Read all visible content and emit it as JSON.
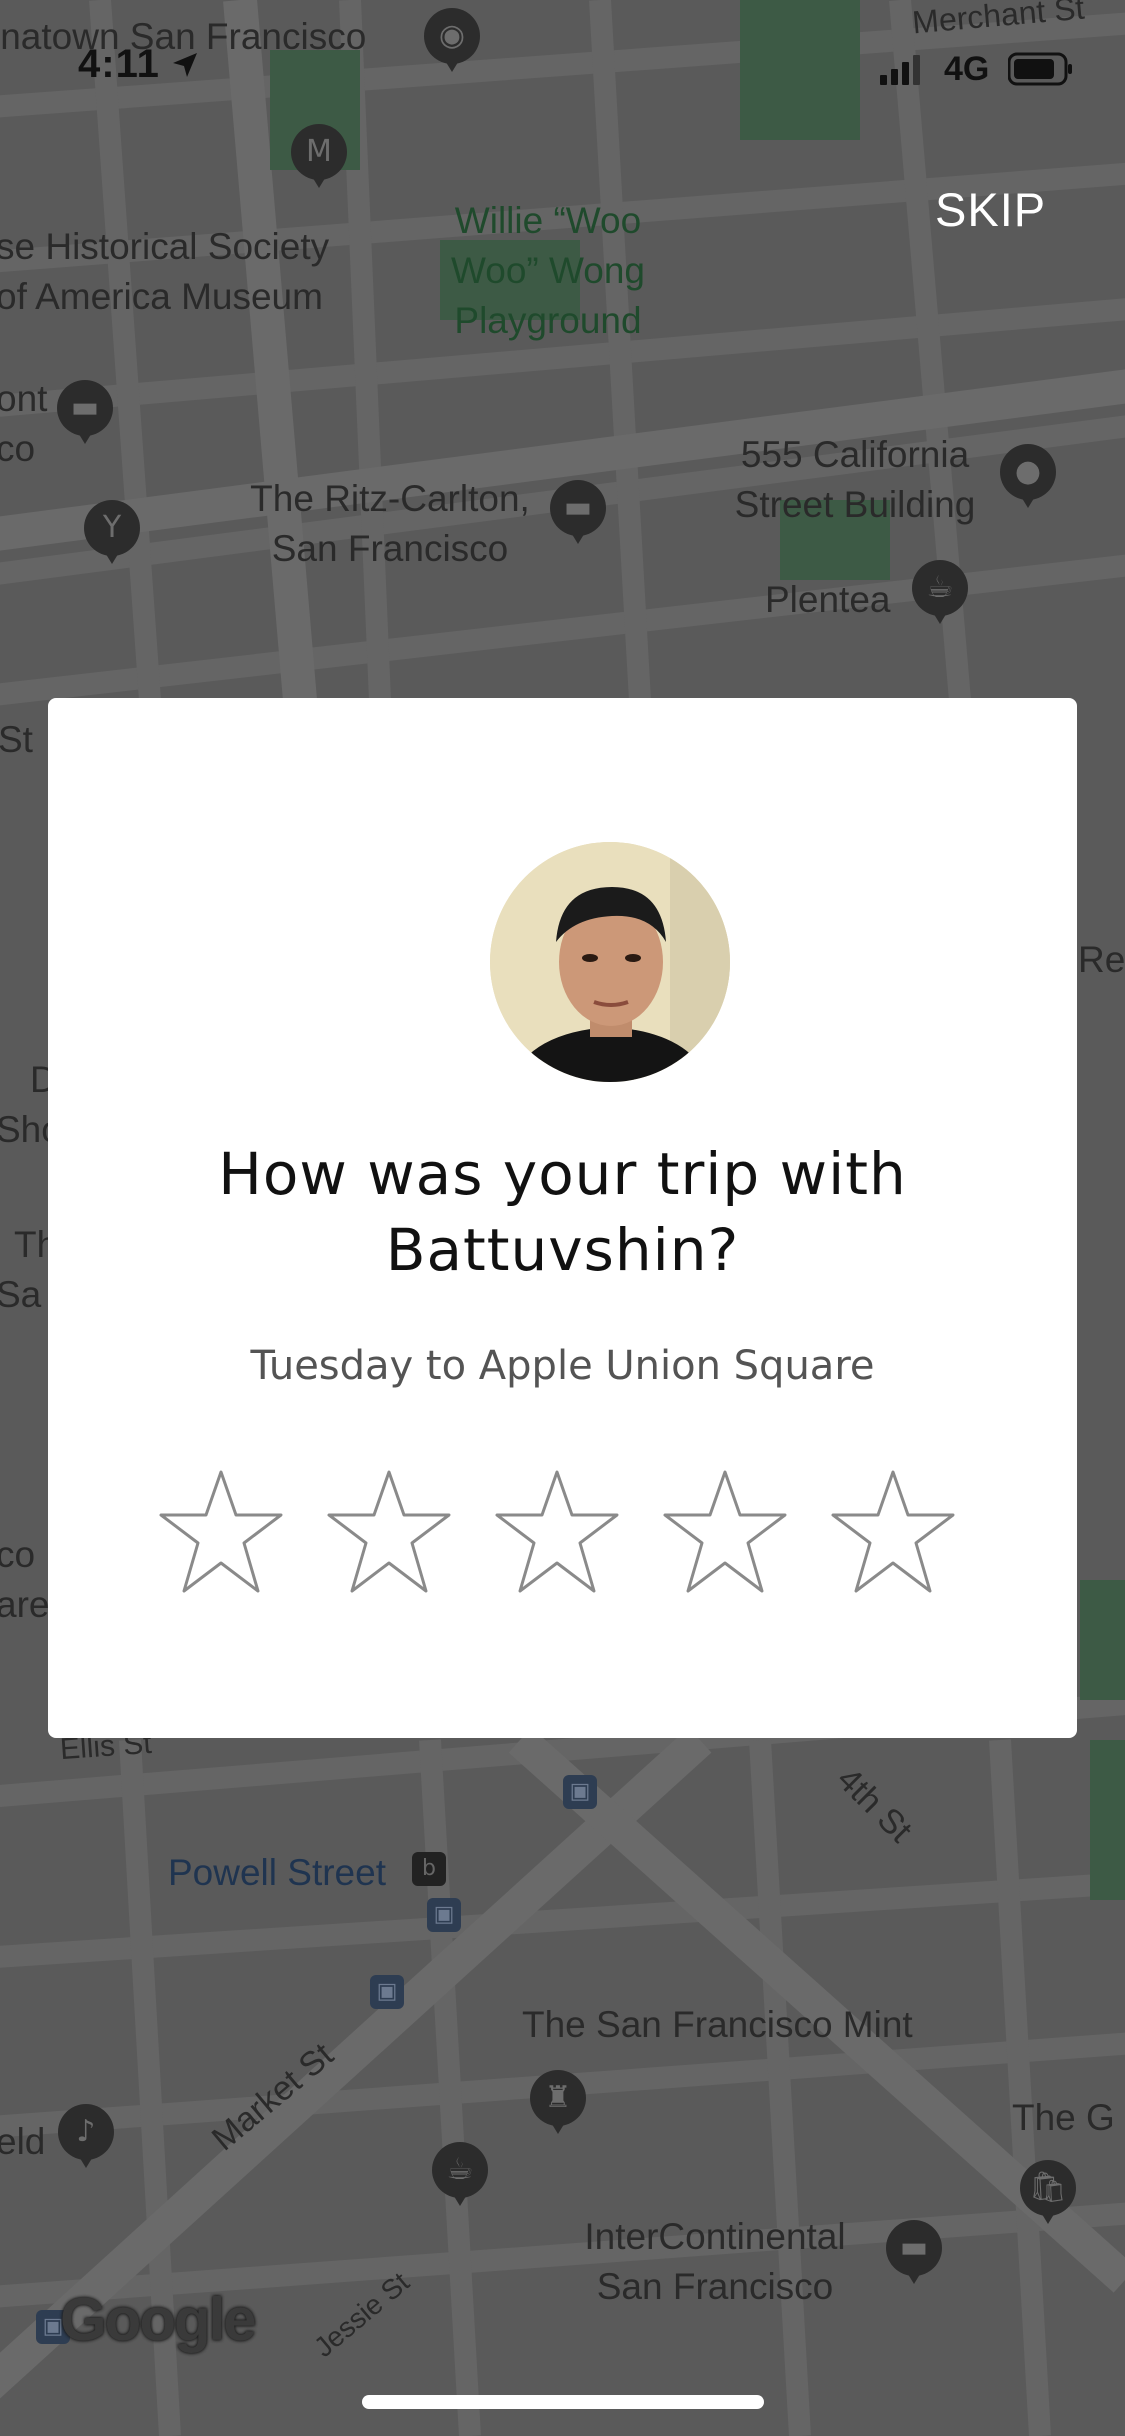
{
  "status_bar": {
    "time": "4:11",
    "network": "4G"
  },
  "header": {
    "skip_label": "SKIP"
  },
  "map": {
    "labels": {
      "chinatown": "inatown San Francisco",
      "merchant": "Merchant St",
      "historical_1": "se Historical Society",
      "historical_2": "of America Museum",
      "willie_1": "Willie “Woo",
      "willie_2": "Woo” Wong",
      "willie_3": "Playground",
      "ont": "ont",
      "co": "co",
      "ritz_1": "The Ritz-Carlton,",
      "ritz_2": "San Francisco",
      "california_1": "555 California",
      "california_2": "Street Building",
      "plentea": "Plentea",
      "st_left": "St",
      "re_right": "Re",
      "d_left": "D",
      "sho_left": "Sho",
      "th_left": "Th",
      "sa_left": "Sa",
      "co_left2": "co",
      "are_left": "are",
      "ellis": "Ellis St",
      "fourth": "4th St",
      "powell": "Powell Street",
      "mint": "The San Francisco Mint",
      "market": "Market St",
      "eld": "eld",
      "the_g": "The G",
      "intercontinental_1": "InterContinental",
      "intercontinental_2": "San Francisco",
      "jessie": "Jessie St"
    },
    "attribution": "Google"
  },
  "rating_dialog": {
    "question_line1": "How was your trip with",
    "question_line2": "Battuvshin?",
    "trip_summary": "Tuesday to Apple Union Square",
    "star_count": 5,
    "selected_rating": 0
  },
  "icons": {
    "location_arrow": "location-arrow-icon",
    "signal": "cellular-signal-icon",
    "battery": "battery-icon",
    "star": "star-outline-icon"
  }
}
